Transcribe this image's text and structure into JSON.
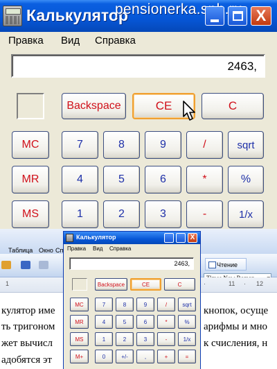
{
  "calculator": {
    "title": "Калькулятор",
    "watermark": "pensionerka.spb.ru",
    "close_glyph": "X",
    "menu": [
      "Правка",
      "Вид",
      "Справка"
    ],
    "display_value": "2463,",
    "buttons": {
      "backspace": "Backspace",
      "ce": "CE",
      "c": "C",
      "mc": "MC",
      "mr": "MR",
      "ms": "MS",
      "mplus": "M+",
      "n7": "7",
      "n8": "8",
      "n9": "9",
      "n4": "4",
      "n5": "5",
      "n6": "6",
      "n1": "1",
      "n2": "2",
      "n3": "3",
      "n0": "0",
      "plusminus": "+/-",
      "comma": ",",
      "div": "/",
      "mul": "*",
      "minus": "-",
      "plus": "+",
      "eq": "=",
      "sqrt": "sqrt",
      "percent": "%",
      "reciprocal": "1/x"
    }
  },
  "word": {
    "menu": [
      "Таблица",
      "Окно",
      "Справка"
    ],
    "read_button": "Чтение",
    "font_name": "Times New Roman",
    "ruler": [
      "1",
      "·",
      "11",
      "·",
      "12"
    ],
    "text_lines": [
      "кулятор име",
      "ть тригоном",
      "жет вычисл",
      "адобятся эт"
    ],
    "text_right": [
      "кнопок, осуще",
      "арифмы и мно",
      "к счисления, н",
      ""
    ]
  },
  "colors": {
    "title_blue": "#0656d6",
    "digit_blue": "#1d2fa8",
    "op_red": "#d0101a",
    "hover_orange": "#f0a030"
  }
}
